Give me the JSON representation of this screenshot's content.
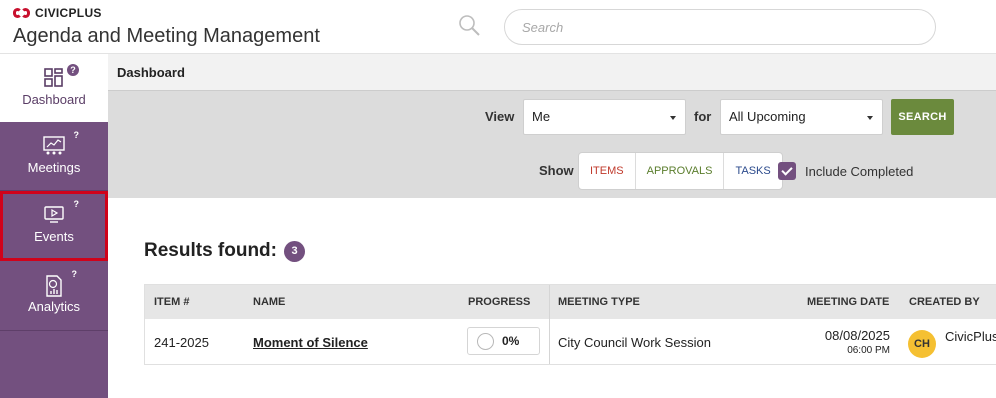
{
  "brand": {
    "name": "CIVICPLUS",
    "app_title": "Agenda and Meeting Management",
    "accent": "#c8102e"
  },
  "search": {
    "placeholder": "Search"
  },
  "sidebar": {
    "color": "#73507f",
    "items": [
      {
        "label": "Dashboard",
        "icon": "dashboard-icon",
        "help": "?"
      },
      {
        "label": "Meetings",
        "icon": "meetings-icon",
        "help": "?"
      },
      {
        "label": "Events",
        "icon": "events-icon",
        "help": "?"
      },
      {
        "label": "Analytics",
        "icon": "analytics-icon",
        "help": "?"
      }
    ]
  },
  "breadcrumb": "Dashboard",
  "filters": {
    "view_label": "View",
    "view_value": "Me",
    "for_label": "for",
    "for_value": "All Upcoming",
    "search_button": "SEARCH",
    "show_label": "Show",
    "show_options": [
      "ITEMS",
      "APPROVALS",
      "TASKS"
    ],
    "include_completed_label": "Include Completed",
    "include_completed_checked": true
  },
  "results": {
    "label": "Results found:",
    "count": "3"
  },
  "table": {
    "columns": [
      "ITEM #",
      "NAME",
      "PROGRESS",
      "MEETING TYPE",
      "MEETING DATE",
      "CREATED BY"
    ],
    "rows": [
      {
        "item_no": "241-2025",
        "name": "Moment of Silence",
        "progress": "0%",
        "meeting_type": "City Council Work Session",
        "meeting_date": "08/08/2025",
        "meeting_time": "06:00 PM",
        "creator_initials": "CH",
        "creator_name": "CivicPlus"
      }
    ]
  }
}
